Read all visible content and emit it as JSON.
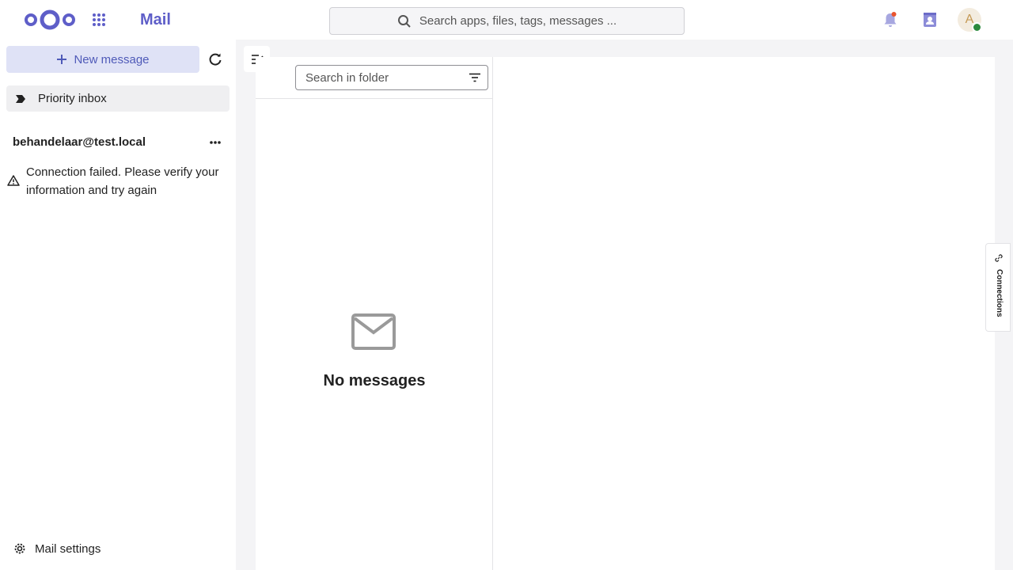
{
  "header": {
    "app_title": "Mail",
    "search_placeholder": "Search apps, files, tags, messages ...",
    "avatar_initial": "A",
    "icons": [
      "nextcloud-logo",
      "apps-grid-icon",
      "search-icon",
      "bell-icon",
      "contacts-icon"
    ]
  },
  "sidebar": {
    "new_message_label": "New message",
    "priority_inbox_label": "Priority inbox",
    "account": {
      "email": "behandelaar@test.local",
      "error": "Connection failed. Please verify your information and try again"
    },
    "settings_label": "Mail settings"
  },
  "message_list": {
    "search_placeholder": "Search in folder",
    "empty_text": "No messages"
  },
  "side_tab": {
    "label": "Connections"
  },
  "colors": {
    "accent": "#5e5ec8",
    "new_message_bg": "#dfe2f6",
    "status_online": "#2b8a3e"
  }
}
